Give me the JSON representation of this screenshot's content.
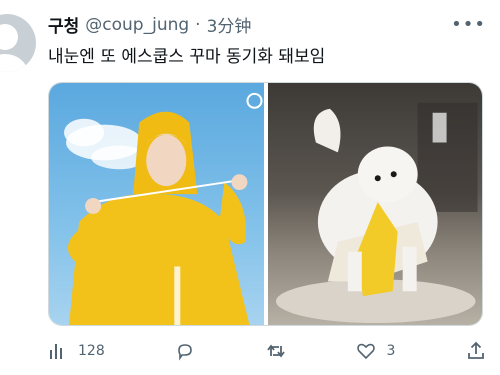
{
  "tweet": {
    "display_name": "구청",
    "handle": "@coup_jung",
    "separator": "·",
    "time": "3分钟",
    "text": "내눈엔 또 에스쿱스 꾸마 동기화 돼보임"
  },
  "icons": {
    "more": "more-icon",
    "views": "views-icon",
    "reply": "reply-icon",
    "retweet": "retweet-icon",
    "like": "like-icon",
    "share": "share-icon"
  },
  "actions": {
    "views_count": "128",
    "likes_count": "3"
  },
  "colors": {
    "text": "#0f1419",
    "secondary": "#536471",
    "border": "#cfd9de"
  }
}
